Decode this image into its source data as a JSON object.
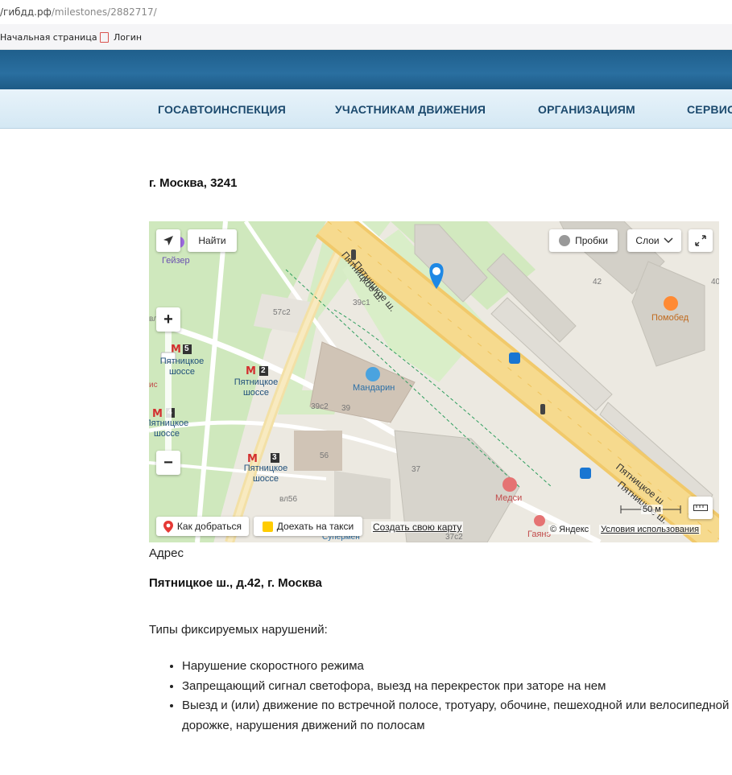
{
  "browser": {
    "url_host": "/гибдд.рф",
    "url_path": "/milestones/2882717/",
    "bookmarks": [
      "Начальная страница",
      "Логин"
    ]
  },
  "nav": {
    "items": [
      "ГОСАВТОИНСПЕКЦИЯ",
      "УЧАСТНИКАМ ДВИЖЕНИЯ",
      "ОРГАНИЗАЦИЯМ",
      "СЕРВИСЫ"
    ]
  },
  "page": {
    "title": "г. Москва, 3241",
    "address_label": "Адрес",
    "address_value": "Пятницкое ш., д.42, г. Москва",
    "violations_label": "Типы фиксируемых нарушений:",
    "violations": [
      "Нарушение скоростного режима",
      "Запрещающий сигнал светофора, выезд на перекресток при заторе на нем",
      "Выезд и (или) движение по встречной полосе, тротуару, обочине, пешеходной или велосипедной дорожке, нарушения движений по полосам"
    ]
  },
  "map": {
    "find_button": "Найти",
    "traffic_button": "Пробки",
    "layers_button": "Слои",
    "route_button": "Как добраться",
    "taxi_button": "Доехать на такси",
    "create_map_link": "Создать свою карту",
    "copyright": "© Яндекс",
    "terms_link": "Условия использования",
    "scale": "50 м",
    "labels": {
      "street1": "Пятницкое ш.",
      "street2": "Пятницкое ш.",
      "street3": "Пятницкое ш.",
      "street4": "Пятницкое ш.",
      "geyser": "Гейзер",
      "metro1": "Пятницкое шоссе",
      "metro2": "Пятницкое шоссе",
      "metro3": "Пятницкое шоссе",
      "metro4": "Пятницкое шоссе",
      "metro_num1": "5",
      "metro_num2": "2",
      "metro_num3": "3",
      "metro_num4": "4",
      "mandarin": "Мандарин",
      "medsi": "Медси",
      "pomobed": "Помобед",
      "gayane": "Гаянэ",
      "supermen": "Супермен",
      "b42": "42",
      "b40": "40",
      "b57c2": "57с2",
      "b39c1": "39с1",
      "b39c2": "39с2",
      "b39": "39",
      "b56": "56",
      "b37": "37",
      "bvl56": "вл56",
      "b37c2": "37с2",
      "left_cut": "вл",
      "left_cut2": "ис"
    }
  },
  "colors": {
    "header_blue": "#2a6fa0",
    "nav_text": "#1c4a6e",
    "road_yellow": "#f5d47a",
    "park_green": "#c8e6b4",
    "pin_blue": "#1e88e5",
    "metro_red": "#d32f2f"
  }
}
